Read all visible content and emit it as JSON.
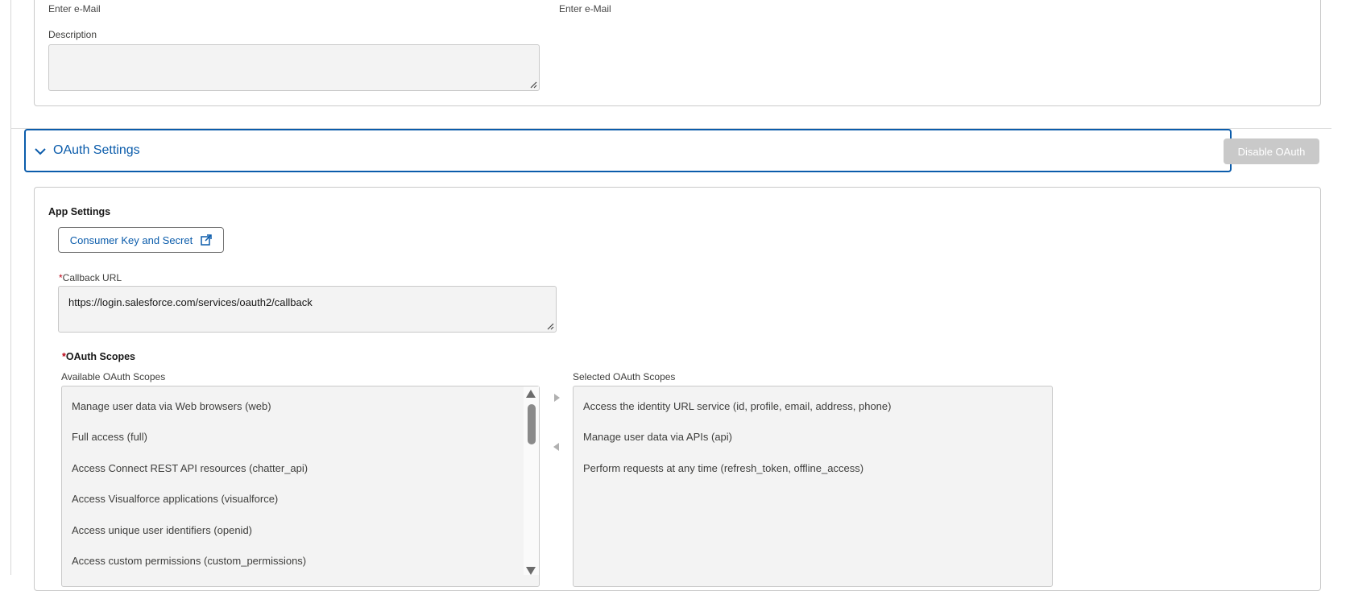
{
  "top_section": {
    "cut_label_left": "Enter e-Mail",
    "cut_label_right": "Enter e-Mail",
    "description_label": "Description",
    "description_value": ""
  },
  "oauth_header": {
    "title": "OAuth Settings",
    "disable_button": "Disable OAuth"
  },
  "app_settings": {
    "heading": "App Settings",
    "consumer_button": "Consumer Key and Secret",
    "callback_required_mark": "*",
    "callback_label": "Callback URL",
    "callback_value": "https://login.salesforce.com/services/oauth2/callback"
  },
  "scopes": {
    "required_mark": "*",
    "title": "OAuth Scopes",
    "available_label": "Available OAuth Scopes",
    "selected_label": "Selected OAuth Scopes",
    "available": [
      "Manage user data via Web browsers (web)",
      "Full access (full)",
      "Access Connect REST API resources (chatter_api)",
      "Access Visualforce applications (visualforce)",
      "Access unique user identifiers (openid)",
      "Access custom permissions (custom_permissions)"
    ],
    "selected": [
      "Access the identity URL service (id, profile, email, address, phone)",
      "Manage user data via APIs (api)",
      "Perform requests at any time (refresh_token, offline_access)"
    ]
  },
  "colors": {
    "brand_blue": "#0b5cab",
    "disabled_button": "#c9c9c9",
    "field_bg": "#f3f3f3",
    "required_red": "#ba0517"
  },
  "icons": {
    "chevron": "chevron-down-icon",
    "external": "new-window-icon",
    "move_right": "triangle-right-icon",
    "move_left": "triangle-left-icon"
  }
}
